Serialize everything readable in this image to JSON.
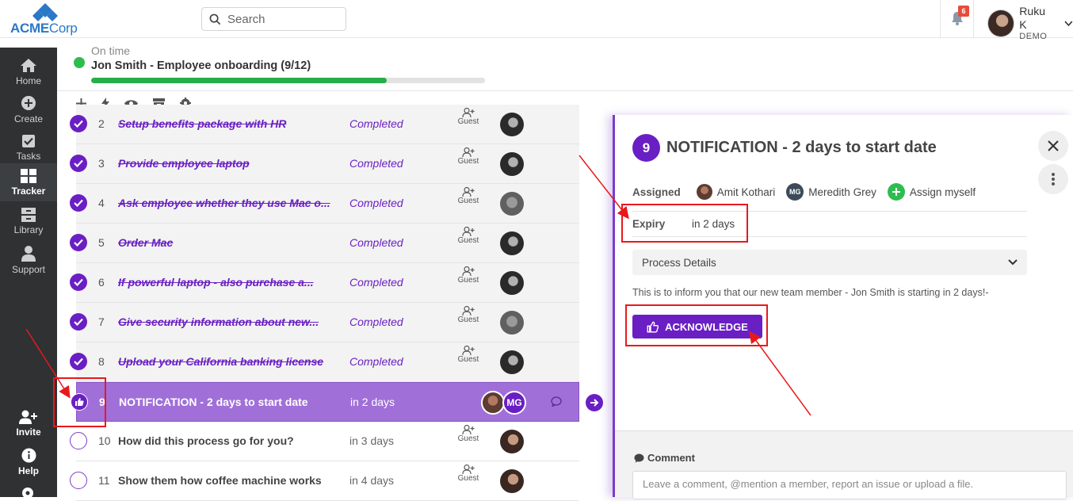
{
  "header": {
    "logo_bold": "ACME",
    "logo_thin": "Corp",
    "search_placeholder": "Search",
    "notification_count": "6",
    "user_name": "Ruku K",
    "user_org": "DEMO"
  },
  "sidebar": {
    "items": [
      {
        "label": "Home",
        "icon": "home-icon"
      },
      {
        "label": "Create",
        "icon": "plus-circle-icon"
      },
      {
        "label": "Tasks",
        "icon": "check-square-icon"
      },
      {
        "label": "Tracker",
        "icon": "grid-icon"
      },
      {
        "label": "Library",
        "icon": "archive-icon"
      },
      {
        "label": "Support",
        "icon": "person-icon"
      }
    ],
    "bottom": [
      {
        "label": "Invite",
        "icon": "add-user-icon"
      },
      {
        "label": "Help",
        "icon": "info-icon"
      }
    ]
  },
  "process": {
    "status": "On time",
    "title": "Jon Smith - Employee onboarding (9/12)",
    "progress_pct": 75,
    "status_color": "#2ebc4f"
  },
  "tasks": [
    {
      "num": "2",
      "name": "Setup benefits package with HR",
      "status": "Completed",
      "guest": "Guest"
    },
    {
      "num": "3",
      "name": "Provide employee laptop",
      "status": "Completed",
      "guest": "Guest"
    },
    {
      "num": "4",
      "name": "Ask employee whether they use Mac o...",
      "status": "Completed",
      "guest": "Guest"
    },
    {
      "num": "5",
      "name": "Order Mac",
      "status": "Completed",
      "guest": "Guest"
    },
    {
      "num": "6",
      "name": "If powerful laptop - also purchase a...",
      "status": "Completed",
      "guest": "Guest"
    },
    {
      "num": "7",
      "name": "Give security information about new...",
      "status": "Completed",
      "guest": "Guest"
    },
    {
      "num": "8",
      "name": "Upload your California banking license",
      "status": "Completed",
      "guest": "Guest"
    },
    {
      "num": "9",
      "name": "NOTIFICATION - 2 days to start date",
      "status": "in 2 days",
      "assignee_initials": "MG"
    },
    {
      "num": "10",
      "name": "How did this process go for you?",
      "status": "in 3 days",
      "guest": "Guest"
    },
    {
      "num": "11",
      "name": "Show them how coffee machine works",
      "status": "in 4 days",
      "guest": "Guest"
    }
  ],
  "panel": {
    "num": "9",
    "title": "NOTIFICATION - 2 days to start date",
    "assigned_label": "Assigned",
    "assignees": [
      "Amit Kothari",
      "Meredith Grey"
    ],
    "mg_initials": "MG",
    "assign_myself": "Assign myself",
    "expiry_label": "Expiry",
    "expiry_value": "in 2 days",
    "details_label": "Process Details",
    "message": "This is to inform you that our new team member - Jon Smith is starting in 2 days!-",
    "ack_label": "ACKNOWLEDGE",
    "comment_label": "Comment",
    "comment_placeholder": "Leave a comment, @mention a member, report an issue or upload a file."
  },
  "colors": {
    "brand": "#2a78c8",
    "accent": "#6a1fc4",
    "highlight_row": "#a070d8",
    "annotation": "#e8191b"
  }
}
